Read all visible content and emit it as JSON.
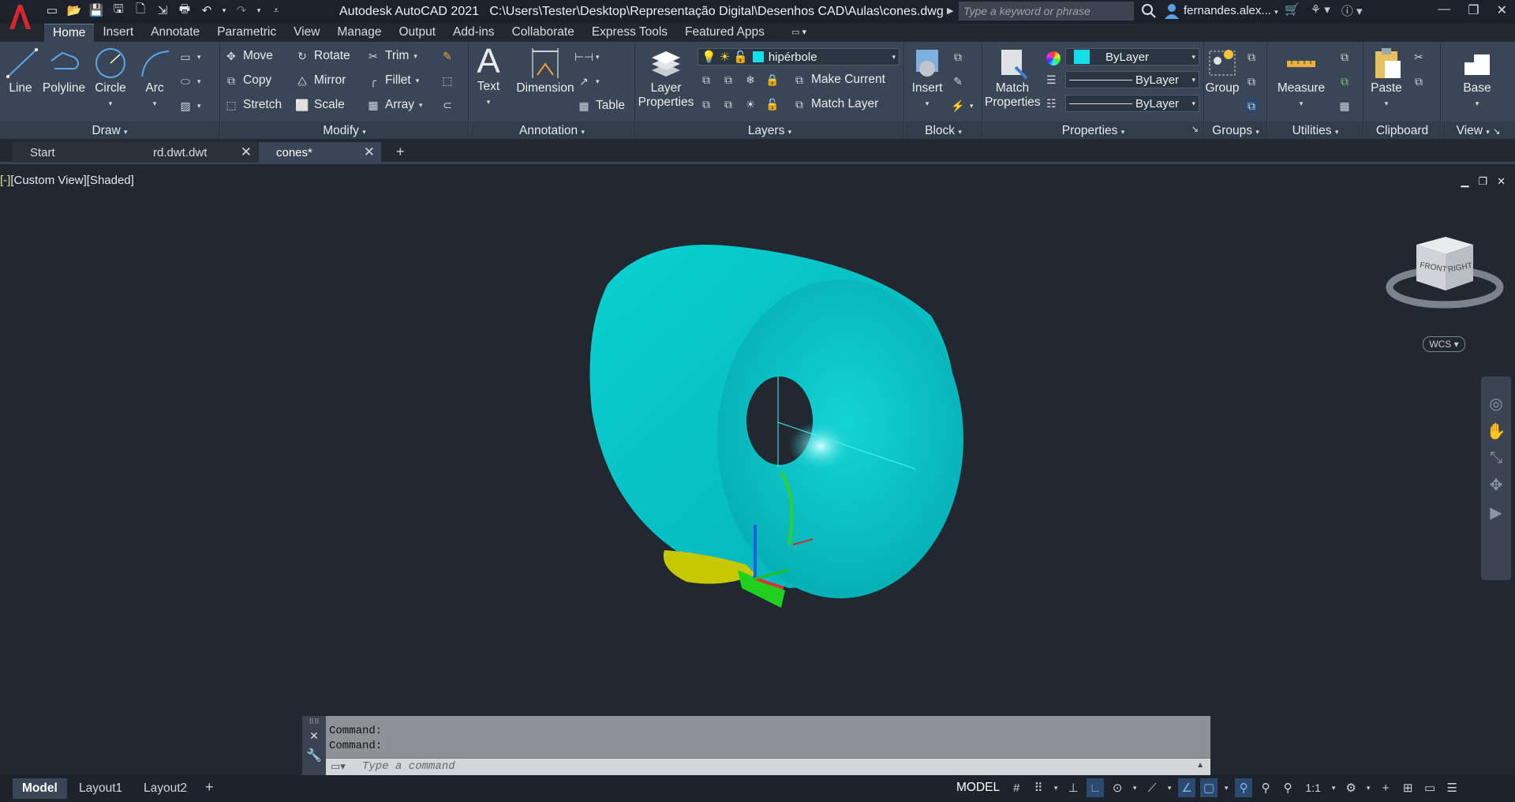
{
  "app": {
    "title": "Autodesk AutoCAD 2021",
    "path": "C:\\Users\\Tester\\Desktop\\Representação Digital\\Desenhos CAD\\Aulas\\cones.dwg",
    "search_placeholder": "Type a keyword or phrase",
    "user": "fernandes.alex...",
    "logo_letter": "A"
  },
  "colors": {
    "accent": "#5d7ea0",
    "model": "#00c8c8",
    "layer_swatch": "#13e0e6",
    "ucs_x": "#e0303a",
    "ucs_y": "#20c020",
    "ucs_z": "#2060e0"
  },
  "ribbon_tabs": [
    "Home",
    "Insert",
    "Annotate",
    "Parametric",
    "View",
    "Manage",
    "Output",
    "Add-ins",
    "Collaborate",
    "Express Tools",
    "Featured Apps"
  ],
  "draw": {
    "line": "Line",
    "polyline": "Polyline",
    "circle": "Circle",
    "arc": "Arc",
    "title": "Draw"
  },
  "modify": {
    "move": "Move",
    "rotate": "Rotate",
    "trim": "Trim",
    "copy": "Copy",
    "mirror": "Mirror",
    "fillet": "Fillet",
    "stretch": "Stretch",
    "scale": "Scale",
    "array": "Array",
    "title": "Modify"
  },
  "annotation": {
    "text": "Text",
    "dimension": "Dimension",
    "table": "Table",
    "title": "Annotation"
  },
  "layers": {
    "layer_properties": "Layer Properties",
    "current_layer": "hipérbole",
    "make_current": "Make Current",
    "match_layer": "Match Layer",
    "title": "Layers"
  },
  "block": {
    "insert": "Insert",
    "title": "Block"
  },
  "properties": {
    "match_properties": "Match Properties",
    "color": "ByLayer",
    "linetype": "ByLayer",
    "lineweight": "ByLayer",
    "title": "Properties"
  },
  "groups": {
    "group": "Group",
    "title": "Groups"
  },
  "utilities": {
    "measure": "Measure",
    "title": "Utilities"
  },
  "clipboard": {
    "paste": "Paste",
    "title": "Clipboard"
  },
  "view": {
    "base": "Base",
    "title": "View"
  },
  "file_tabs": [
    {
      "label": "Start"
    },
    {
      "label": "rd.dwt.dwt"
    },
    {
      "label": "cones*"
    }
  ],
  "viewport": {
    "label": "[Custom View][Shaded]",
    "wcs": "WCS",
    "cube_front": "FRONT",
    "cube_right": "RIGHT"
  },
  "command": {
    "history": [
      "Command:",
      "Command:"
    ],
    "placeholder": "Type a command"
  },
  "layout_tabs": [
    "Model",
    "Layout1",
    "Layout2"
  ],
  "status": {
    "model": "MODEL",
    "scale": "1:1"
  }
}
